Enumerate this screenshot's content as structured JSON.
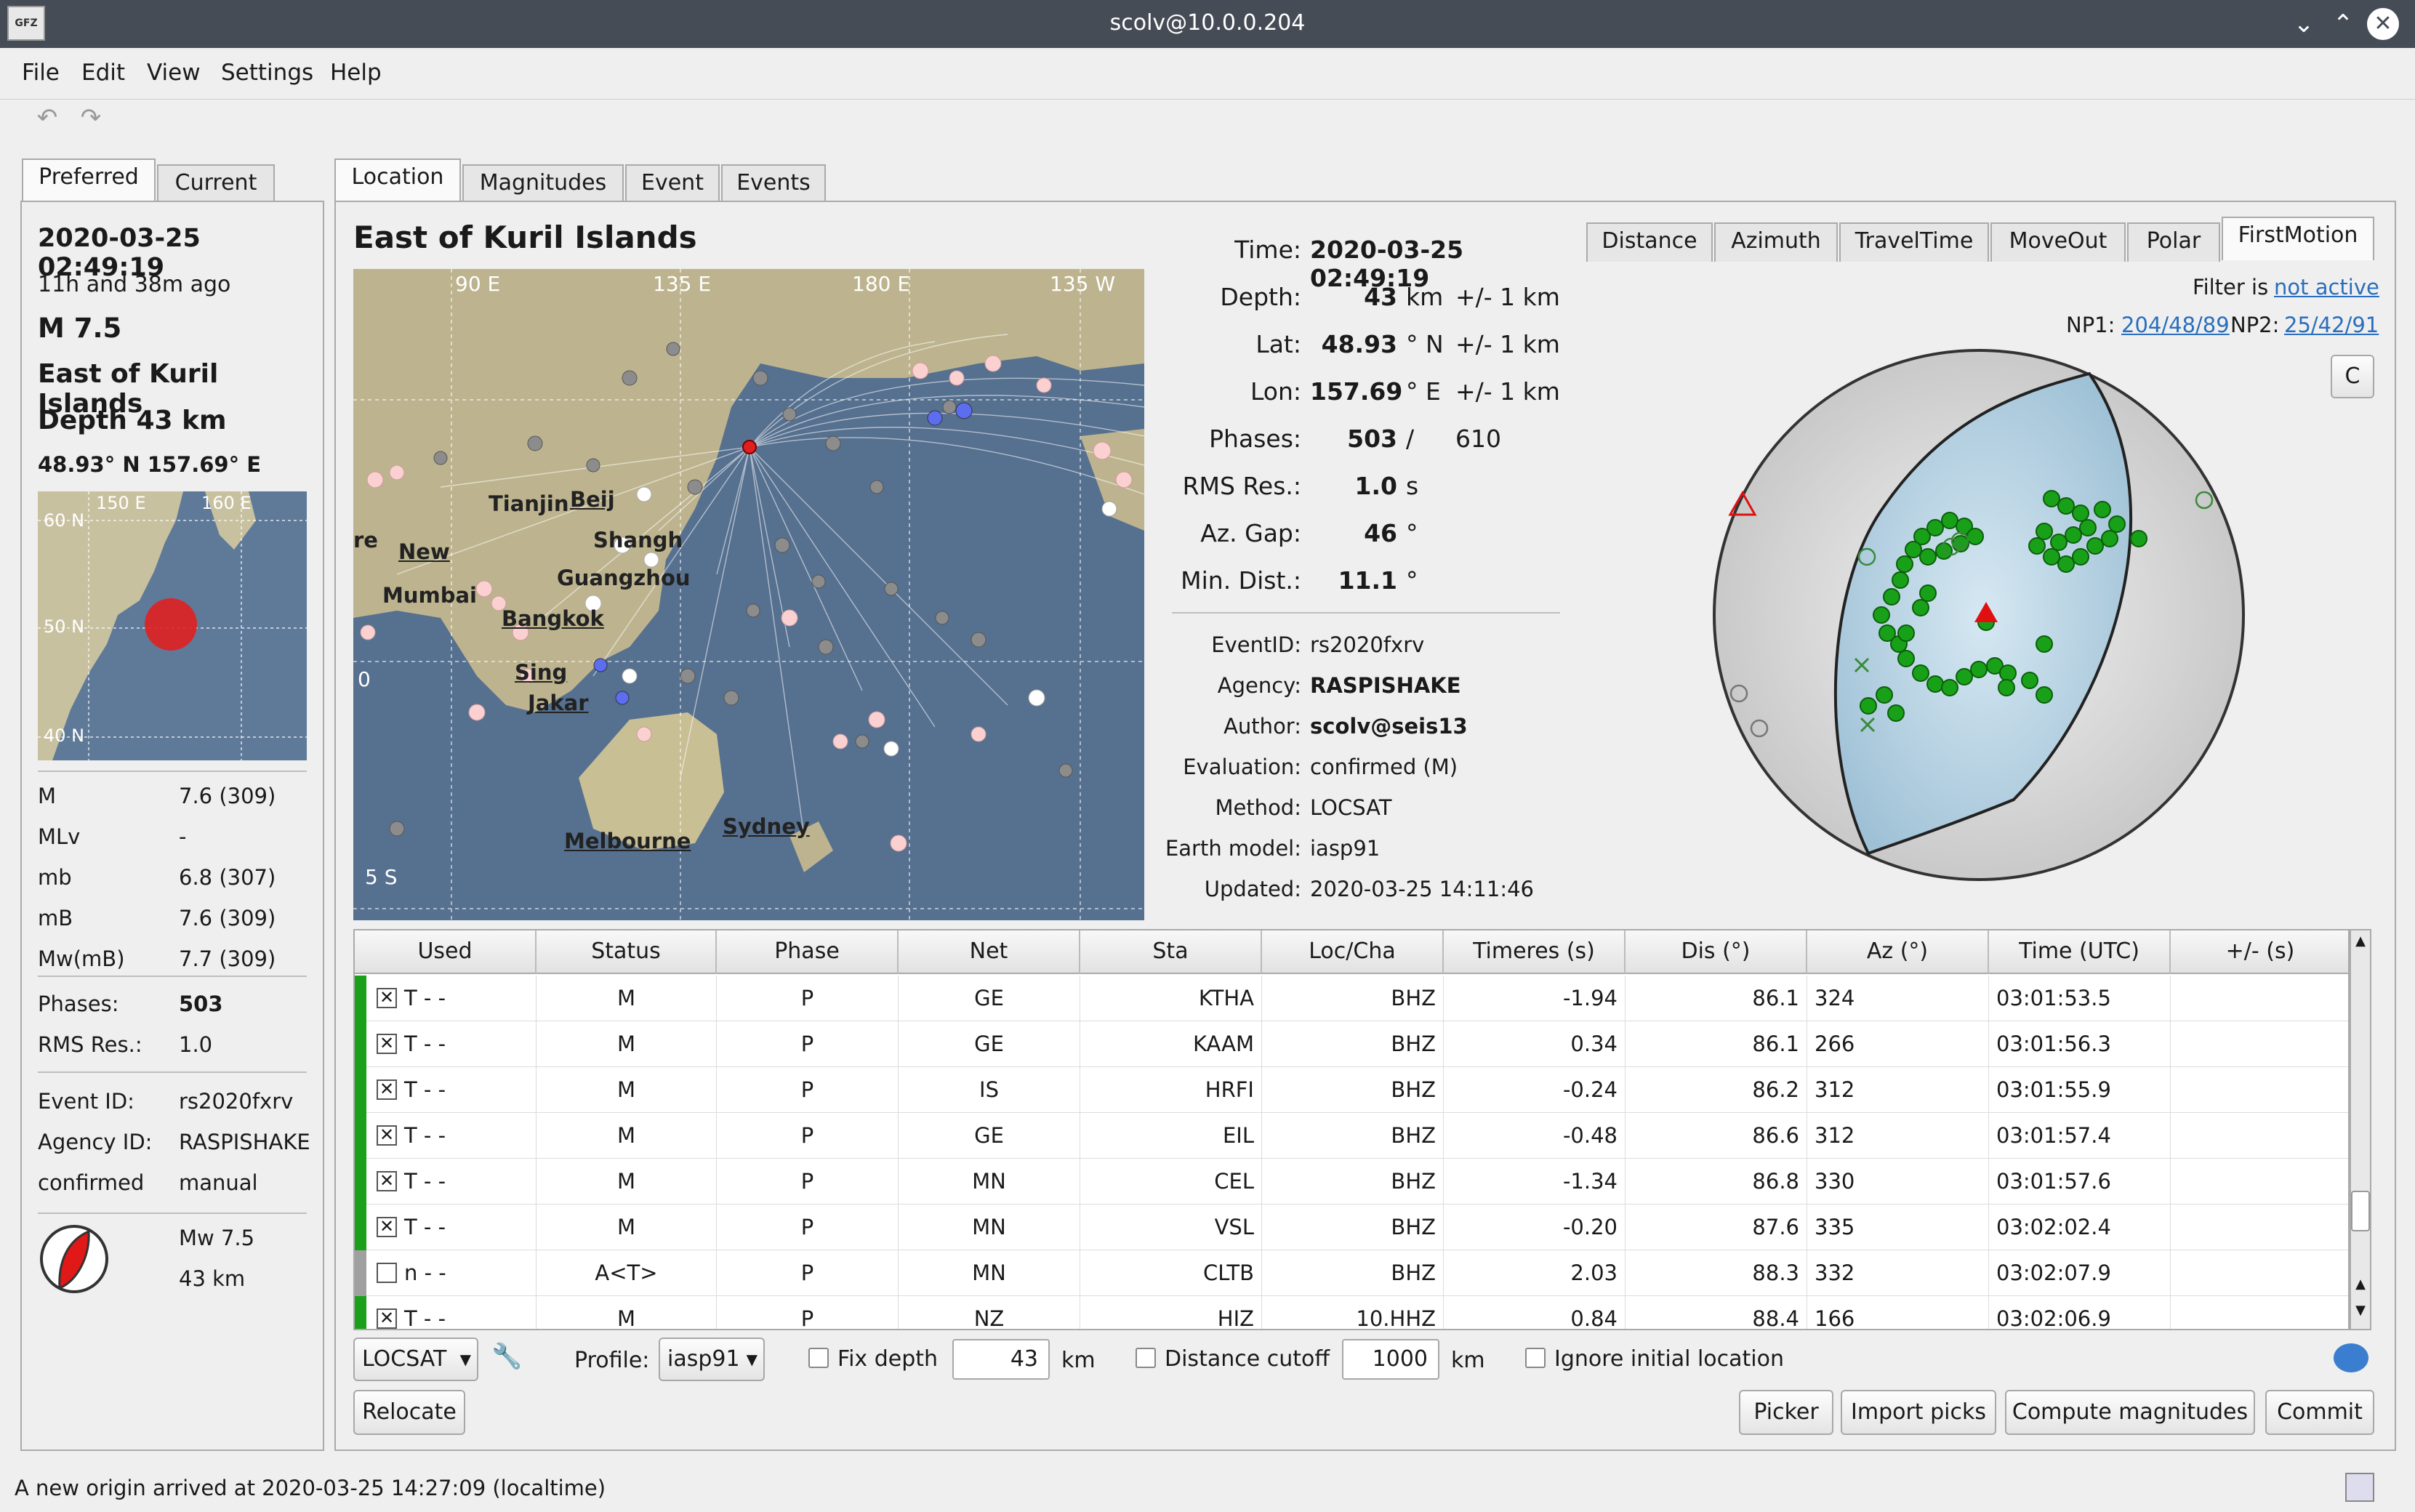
{
  "window": {
    "title": "scolv@10.0.0.204",
    "logo": "GFZ"
  },
  "menu": [
    "File",
    "Edit",
    "View",
    "Settings",
    "Help"
  ],
  "left_tabs": [
    "Preferred",
    "Current"
  ],
  "summary": {
    "datetime": "2020-03-25 02:49:19",
    "ago": "11h and 38m ago",
    "magnitude": "M  7.5",
    "region": "East of Kuril Islands",
    "depth": "Depth  43 km",
    "coords": "48.93° N   157.69° E",
    "minimap_labels": {
      "lon1": "150 E",
      "lon2": "160 E",
      "lat1": "60 N",
      "lat2": "50 N",
      "lat3": "40 N"
    },
    "mags": [
      {
        "k": "M",
        "v": "7.6 (309)"
      },
      {
        "k": "MLv",
        "v": "-"
      },
      {
        "k": "mb",
        "v": "6.8 (307)"
      },
      {
        "k": "mB",
        "v": "7.6 (309)"
      },
      {
        "k": "Mw(mB)",
        "v": "7.7 (309)"
      }
    ],
    "phases_label": "Phases:",
    "phases_value": "503",
    "rms_label": "RMS Res.:",
    "rms_value": "1.0",
    "event_id_label": "Event ID:",
    "event_id": "rs2020fxrv",
    "agency_label": "Agency ID:",
    "agency": "RASPISHAKE",
    "status_label": "confirmed",
    "status_value": "manual",
    "mech_mag": "Mw 7.5",
    "mech_depth": "43 km"
  },
  "main_tabs": [
    "Location",
    "Magnitudes",
    "Event",
    "Events"
  ],
  "location": {
    "region": "East of Kuril Islands",
    "map_labels": {
      "lon90": "90 E",
      "lon135": "135 E",
      "lon180": "180 E",
      "lon135w": "135 W",
      "lat5s": "5 S",
      "lat0": "0",
      "cities": [
        "Tianjin",
        "Beij",
        "New",
        "Shangh",
        "Guangzhou",
        "Mumbai",
        "Bangkok",
        "Sing",
        "Jakar",
        "Melbourne",
        "Sydney",
        "re"
      ]
    },
    "fields": [
      {
        "k": "Time:",
        "v": "2020-03-25 02:49:19",
        "u": "",
        "e": ""
      },
      {
        "k": "Depth:",
        "v": "43",
        "u": "km",
        "e": "+/- 1  km"
      },
      {
        "k": "Lat:",
        "v": "48.93",
        "u": "° N",
        "e": "+/- 1  km"
      },
      {
        "k": "Lon:",
        "v": "157.69",
        "u": "° E",
        "e": "+/- 1  km"
      },
      {
        "k": "Phases:",
        "v": "503",
        "u": "/",
        "e": "610"
      },
      {
        "k": "RMS Res.:",
        "v": "1.0",
        "u": "s",
        "e": ""
      },
      {
        "k": "Az. Gap:",
        "v": "46",
        "u": "°",
        "e": ""
      },
      {
        "k": "Min. Dist.:",
        "v": "11.1",
        "u": "°",
        "e": ""
      }
    ],
    "info": [
      {
        "k": "EventID:",
        "v": "rs2020fxrv",
        "b": false
      },
      {
        "k": "Agency:",
        "v": "RASPISHAKE",
        "b": true
      },
      {
        "k": "Author:",
        "v": "scolv@seis13",
        "b": true
      },
      {
        "k": "Evaluation:",
        "v": "confirmed (M)",
        "b": false
      },
      {
        "k": "Method:",
        "v": "LOCSAT",
        "b": false
      },
      {
        "k": "Earth model:",
        "v": "iasp91",
        "b": false
      },
      {
        "k": "Updated:",
        "v": "2020-03-25 14:11:46",
        "b": false
      }
    ]
  },
  "plot_tabs": [
    "Distance",
    "Azimuth",
    "TravelTime",
    "MoveOut",
    "Polar",
    "FirstMotion"
  ],
  "firstmotion": {
    "filter_label": "Filter is",
    "filter_value": "not active",
    "np1_label": "NP1:",
    "np1": "204/48/89",
    "np2_label": "NP2:",
    "np2": "25/42/91",
    "c_button": "C"
  },
  "table": {
    "headers": [
      "Used",
      "Status",
      "Phase",
      "Net",
      "Sta",
      "Loc/Cha",
      "Timeres (s)",
      "Dis (°)",
      "Az (°)",
      "Time (UTC)",
      "+/- (s)"
    ],
    "rows": [
      {
        "used": "T  -  -",
        "checked": true,
        "status": "M",
        "phase": "P",
        "net": "GE",
        "sta": "KTHA",
        "cha": "BHZ",
        "res": "-1.94",
        "dis": "86.1",
        "az": "324",
        "time": "03:01:53.5",
        "err": "",
        "color": "#1aa01a"
      },
      {
        "used": "T  -  -",
        "checked": true,
        "status": "M",
        "phase": "P",
        "net": "GE",
        "sta": "KAAM",
        "cha": "BHZ",
        "res": "0.34",
        "dis": "86.1",
        "az": "266",
        "time": "03:01:56.3",
        "err": "",
        "color": "#1aa01a"
      },
      {
        "used": "T  -  -",
        "checked": true,
        "status": "M",
        "phase": "P",
        "net": "IS",
        "sta": "HRFI",
        "cha": "BHZ",
        "res": "-0.24",
        "dis": "86.2",
        "az": "312",
        "time": "03:01:55.9",
        "err": "",
        "color": "#1aa01a"
      },
      {
        "used": "T  -  -",
        "checked": true,
        "status": "M",
        "phase": "P",
        "net": "GE",
        "sta": "EIL",
        "cha": "BHZ",
        "res": "-0.48",
        "dis": "86.6",
        "az": "312",
        "time": "03:01:57.4",
        "err": "",
        "color": "#1aa01a"
      },
      {
        "used": "T  -  -",
        "checked": true,
        "status": "M",
        "phase": "P",
        "net": "MN",
        "sta": "CEL",
        "cha": "BHZ",
        "res": "-1.34",
        "dis": "86.8",
        "az": "330",
        "time": "03:01:57.6",
        "err": "",
        "color": "#1aa01a"
      },
      {
        "used": "T  -  -",
        "checked": true,
        "status": "M",
        "phase": "P",
        "net": "MN",
        "sta": "VSL",
        "cha": "BHZ",
        "res": "-0.20",
        "dis": "87.6",
        "az": "335",
        "time": "03:02:02.4",
        "err": "",
        "color": "#1aa01a"
      },
      {
        "used": "n  -  -",
        "checked": false,
        "status": "A<T>",
        "phase": "P",
        "net": "MN",
        "sta": "CLTB",
        "cha": "BHZ",
        "res": "2.03",
        "dis": "88.3",
        "az": "332",
        "time": "03:02:07.9",
        "err": "",
        "color": "#a0a0a0"
      },
      {
        "used": "T  -  -",
        "checked": true,
        "status": "M",
        "phase": "P",
        "net": "NZ",
        "sta": "HIZ",
        "cha": "10.HHZ",
        "res": "0.84",
        "dis": "88.4",
        "az": "166",
        "time": "03:02:06.9",
        "err": "",
        "color": "#1aa01a"
      }
    ]
  },
  "controls": {
    "method": "LOCSAT",
    "profile_label": "Profile:",
    "profile": "iasp91",
    "fix_depth": "Fix depth",
    "depth_value": "43",
    "km": "km",
    "distance_cutoff": "Distance cutoff",
    "cutoff_value": "1000",
    "ignore_initial": "Ignore initial location",
    "relocate": "Relocate",
    "picker": "Picker",
    "import_picks": "Import picks",
    "compute_mags": "Compute magnitudes",
    "commit": "Commit"
  },
  "statusbar": "A new origin arrived at 2020-03-25 14:27:09 (localtime)"
}
